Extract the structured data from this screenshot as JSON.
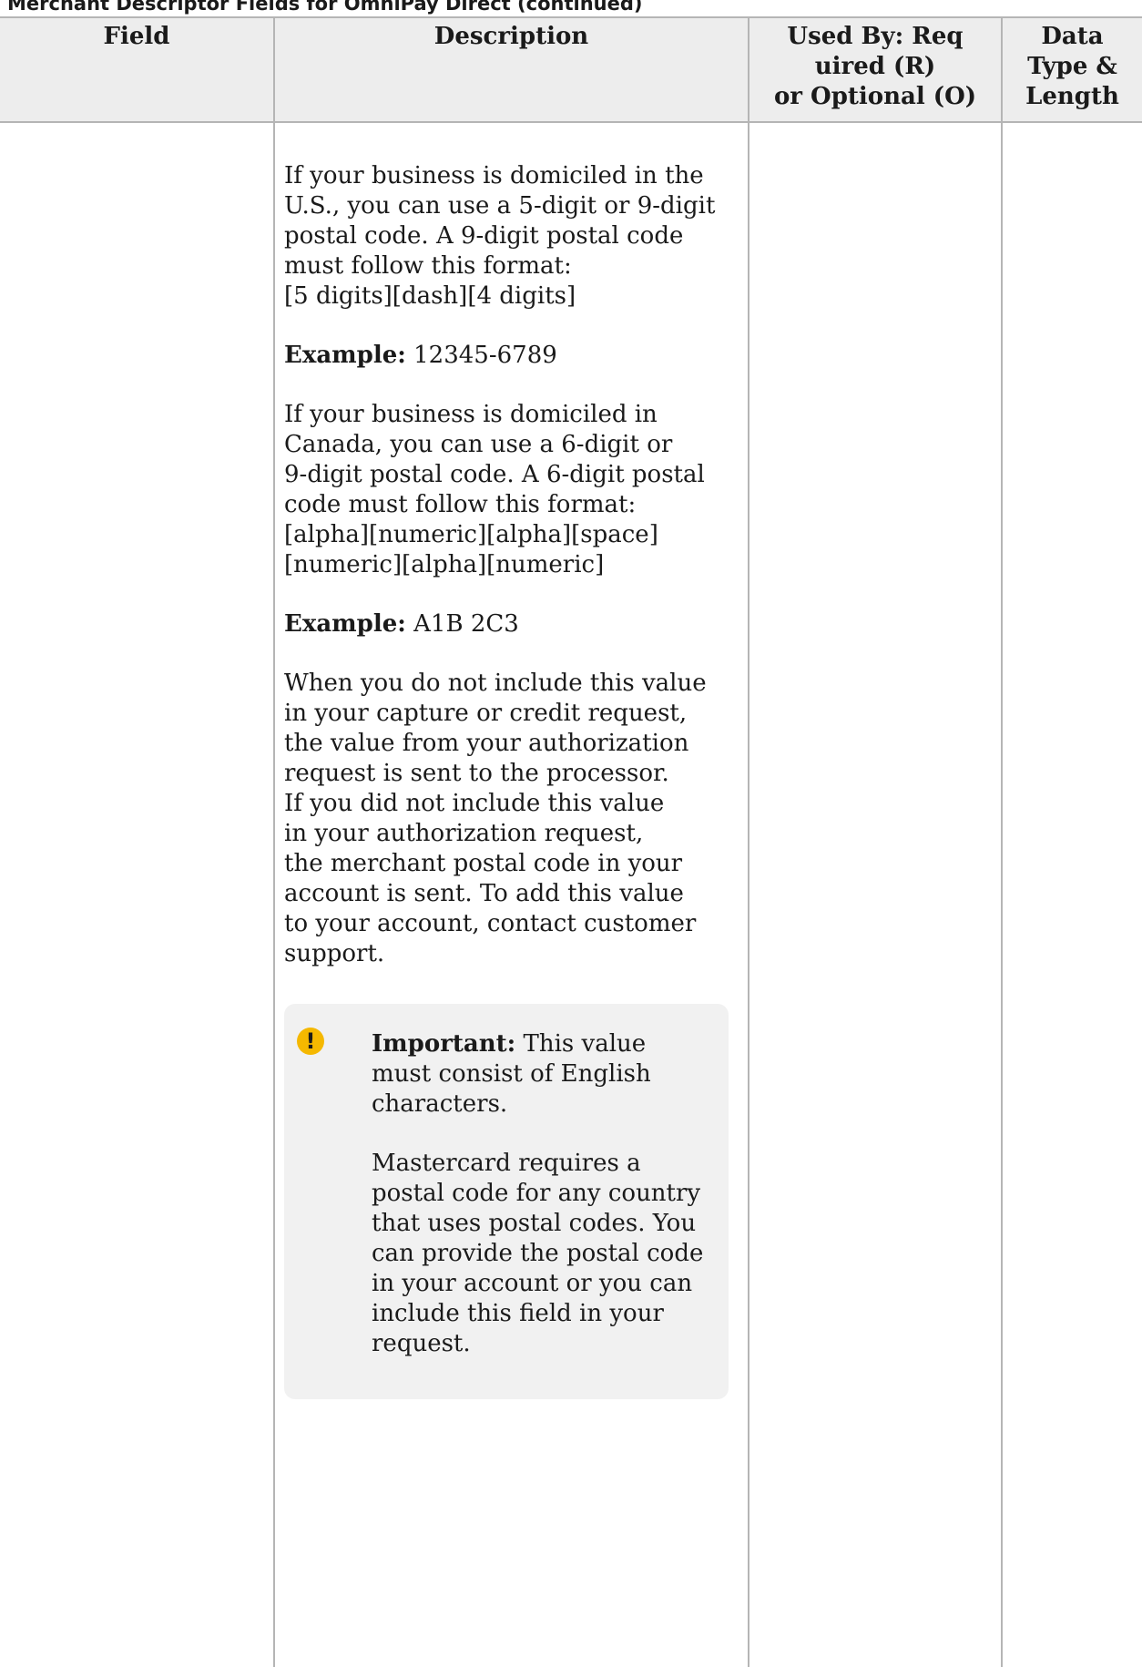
{
  "caption": "Merchant Descriptor Fields for OmniPay Direct (continued)",
  "table": {
    "headers": {
      "field": "Field",
      "description": "Description",
      "used_by": "Used By: Req\nuired (R)\nor Optional (O)",
      "data_type": "Data\nType &\nLength"
    },
    "row": {
      "field": "",
      "used_by": "",
      "data_type": "",
      "description": {
        "p1": "If your business is domiciled in the\nU.S., you can use a 5-digit or 9-digit\npostal code. A 9-digit postal code\nmust follow this format:\n[5 digits][dash][4 digits]",
        "example1_label": "Example:",
        "example1_value": " 12345-6789",
        "p2": "If your business is domiciled in\nCanada, you can use a 6-digit or\n9-digit postal code. A 6-digit postal\ncode must follow this format:\n[alpha][numeric][alpha][space]\n[numeric][alpha][numeric]",
        "example2_label": "Example:",
        "example2_value": " A1B 2C3",
        "p3": "When you do not include this value\nin your capture or credit request,\nthe value from your authorization\nrequest is sent to the processor.\nIf you did not include this value\nin your authorization request,\nthe merchant postal code in your\naccount is sent. To add this value\nto your account, contact customer\nsupport."
      }
    }
  },
  "note": {
    "icon": "exclamation-icon",
    "icon_glyph": "!",
    "icon_color": "#f5b800",
    "label": "Important:",
    "text1": " This value\nmust consist of English\ncharacters.",
    "text2": "Mastercard requires a\npostal code for any country\nthat uses postal codes. You\ncan provide the postal code\nin your account or you can\ninclude this field in your\nrequest."
  }
}
